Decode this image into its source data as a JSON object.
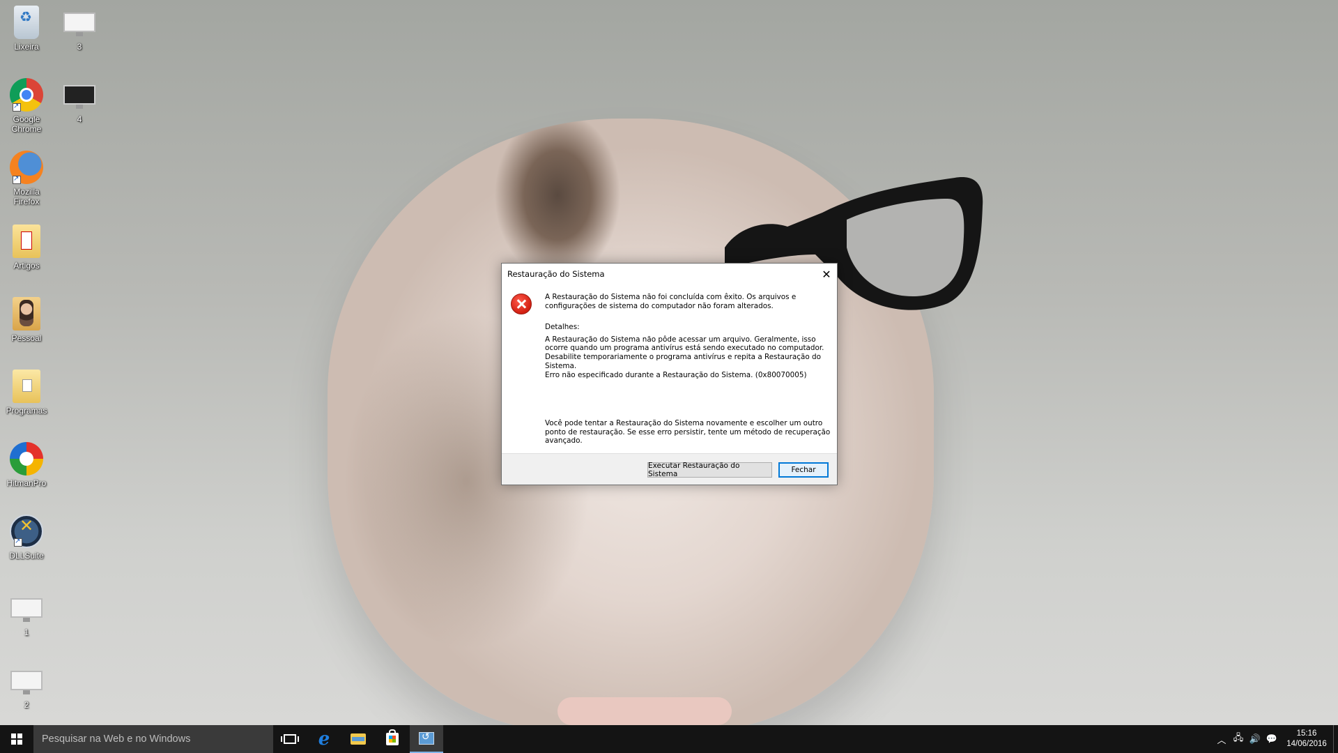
{
  "desktop": {
    "icons": [
      {
        "label": "Lixeira",
        "icon": "recycle-bin-icon"
      },
      {
        "label": "3",
        "icon": "monitor-icon"
      },
      {
        "label": "Google Chrome",
        "icon": "chrome-icon"
      },
      {
        "label": "4",
        "icon": "monitor-icon"
      },
      {
        "label": "Mozilla Firefox",
        "icon": "firefox-icon"
      },
      {
        "label": "Artigos",
        "icon": "folder-icon"
      },
      {
        "label": "Pessoal",
        "icon": "folder-icon"
      },
      {
        "label": "Programas",
        "icon": "folder-icon"
      },
      {
        "label": "HitmanPro",
        "icon": "hitmanpro-icon"
      },
      {
        "label": "DLLSuite",
        "icon": "dllsuite-icon"
      },
      {
        "label": "1",
        "icon": "monitor-icon"
      },
      {
        "label": "2",
        "icon": "monitor-icon"
      }
    ]
  },
  "dialog": {
    "title": "Restauração do Sistema",
    "icon": "error-icon",
    "main_message": "A Restauração do Sistema não foi concluída com êxito. Os arquivos e configurações de sistema do computador não foram alterados.",
    "details_label": "Detalhes:",
    "details_text": "A Restauração do Sistema não pôde acessar um arquivo. Geralmente, isso ocorre quando um programa antivírus está sendo executado no computador. Desabilite temporariamente o programa antivírus e repita a Restauração do Sistema.",
    "error_text": "Erro não especificado durante a Restauração do Sistema. (0x80070005)",
    "suggestion": "Você pode tentar a Restauração do Sistema novamente e escolher um outro ponto de restauração. Se esse erro persistir, tente um método de recuperação avançado.",
    "buttons": {
      "run": "Executar Restauração do Sistema",
      "close": "Fechar"
    }
  },
  "taskbar": {
    "search_placeholder": "Pesquisar na Web e no Windows",
    "clock_time": "15:16",
    "clock_date": "14/06/2016",
    "pinned": [
      "task-view-icon",
      "edge-icon",
      "file-explorer-icon",
      "store-icon",
      "system-restore-icon"
    ]
  }
}
